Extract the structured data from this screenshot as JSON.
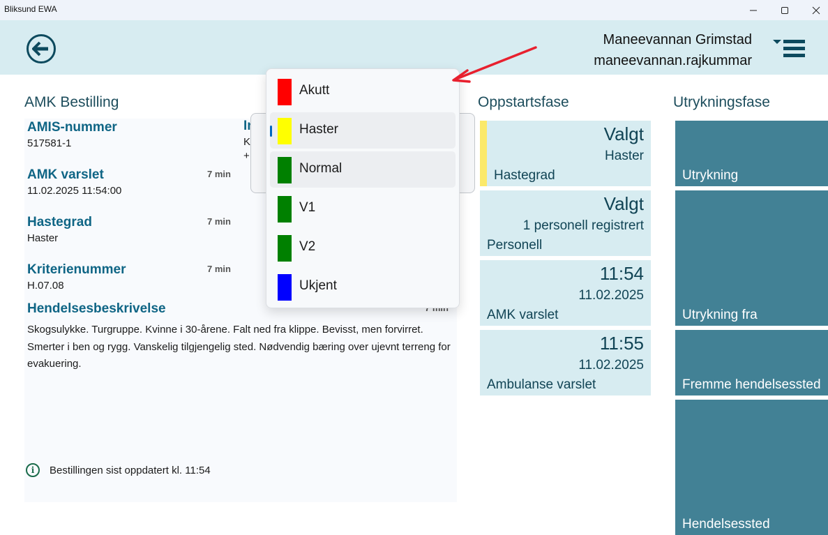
{
  "window": {
    "title": "Bliksund EWA",
    "controls": {
      "minimize": "—",
      "maximize": "☐",
      "close": "✕"
    }
  },
  "header": {
    "back_icon": "arrow-left-circle-icon",
    "user_name": "Maneevannan Grimstad",
    "user_login": "maneevannan.rajkummar",
    "menu_icon": "hamburger-menu-icon"
  },
  "amk": {
    "section_title": "AMK Bestilling",
    "fields": [
      {
        "label": "AMIS-nummer",
        "value": "517581-1",
        "age": ""
      },
      {
        "label": "AMK varslet",
        "value": "11.02.2025 11:54:00",
        "age": "7 min"
      },
      {
        "label": "Hastegrad",
        "value": "Haster",
        "age": "7 min"
      },
      {
        "label": "Kriterienummer",
        "value": "H.07.08",
        "age": "7 min"
      }
    ],
    "partial_column": {
      "label": "In",
      "line1": "K",
      "line2": "+"
    },
    "description_label": "Hendelsesbeskrivelse",
    "description_age": "7 min",
    "description_text": "Skogsulykke. Turgruppe. Kvinne i 30-årene. Falt ned fra klippe. Bevisst, men forvirret. Smerter i ben og rygg. Vanskelig tilgjengelig sted. Nødvendig bæring over ujevnt terreng for evakuering.",
    "info_text": "Bestillingen sist oppdatert kl. 11:54",
    "info_icon": "info-icon"
  },
  "dropdown": {
    "selected": "Haster",
    "options": [
      {
        "label": "Akutt",
        "color": "#ff0000"
      },
      {
        "label": "Haster",
        "color": "#ffff00"
      },
      {
        "label": "Normal",
        "color": "#008000"
      },
      {
        "label": "V1",
        "color": "#008000"
      },
      {
        "label": "V2",
        "color": "#008000"
      },
      {
        "label": "Ukjent",
        "color": "#0000ff"
      }
    ]
  },
  "annotation": {
    "arrow_color": "#e8202e"
  },
  "oppstartsfase": {
    "section_title": "Oppstartsfase",
    "tiles": [
      {
        "big": "Valgt",
        "sub": "Haster",
        "name": "Hastegrad",
        "stripe_color": "#fbe96a"
      },
      {
        "big": "Valgt",
        "sub": "1 personell registrert",
        "name": "Personell"
      },
      {
        "big": "11:54",
        "sub": "11.02.2025",
        "name": "AMK varslet"
      },
      {
        "big": "11:55",
        "sub": "11.02.2025",
        "name": "Ambulanse varslet"
      }
    ]
  },
  "utrykningsfase": {
    "section_title": "Utrykningsfase",
    "tiles": [
      {
        "name": "Utrykning"
      },
      {
        "name": "Utrykning fra"
      },
      {
        "name": "Fremme hendelsessted"
      },
      {
        "name": "Hendelsessted"
      }
    ]
  },
  "colors": {
    "header_bg": "#d7ecf1",
    "accent_dark": "#0d4a5e",
    "label_blue": "#0f6585",
    "tile_light": "#d7ecf1",
    "tile_dark": "#428195"
  }
}
